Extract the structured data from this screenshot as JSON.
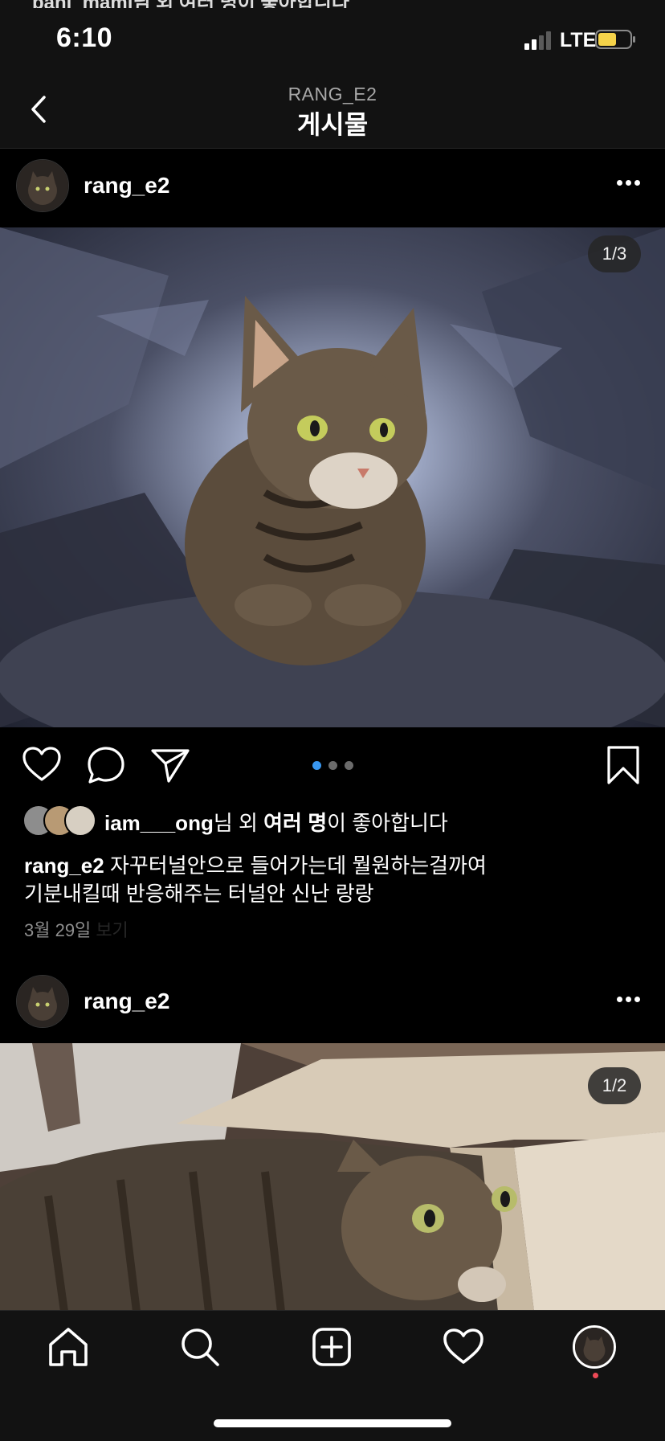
{
  "status_bar": {
    "peek_text": "bani_mami님 외 여러 명이 좋아합니다",
    "time": "6:10",
    "network": "LTE"
  },
  "header": {
    "account": "RANG_E2",
    "title": "게시물"
  },
  "posts": [
    {
      "username": "rang_e2",
      "media_counter": "1/3",
      "carousel_dots": 3,
      "liked_by_user": "iam___ong",
      "liked_by_mid": "님 외 ",
      "liked_by_others": "여러 명",
      "liked_by_suffix": "이 좋아합니다",
      "caption_user": "rang_e2",
      "caption_line1": " 자꾸터널안으로 들어가는데 뭘원하는걸까여",
      "caption_line2": "기분내킬때 반응해주는 터널안 신난 랑랑",
      "date": "3월 29일",
      "view_label": "보기"
    },
    {
      "username": "rang_e2",
      "media_counter": "1/2"
    }
  ],
  "icons": {
    "back": "chevron-left-icon",
    "more": "more-horizontal-icon",
    "like": "heart-icon",
    "comment": "comment-bubble-icon",
    "share": "paper-plane-icon",
    "save": "bookmark-icon",
    "nav": [
      "home-icon",
      "search-icon",
      "add-post-icon",
      "activity-heart-icon",
      "profile-avatar-icon"
    ]
  },
  "colors": {
    "background": "#000000",
    "bar": "#121212",
    "active_dot": "#3897f0",
    "battery": "#f5d34a",
    "notification_dot": "#ed4956",
    "muted_text": "#8e8e8e"
  }
}
